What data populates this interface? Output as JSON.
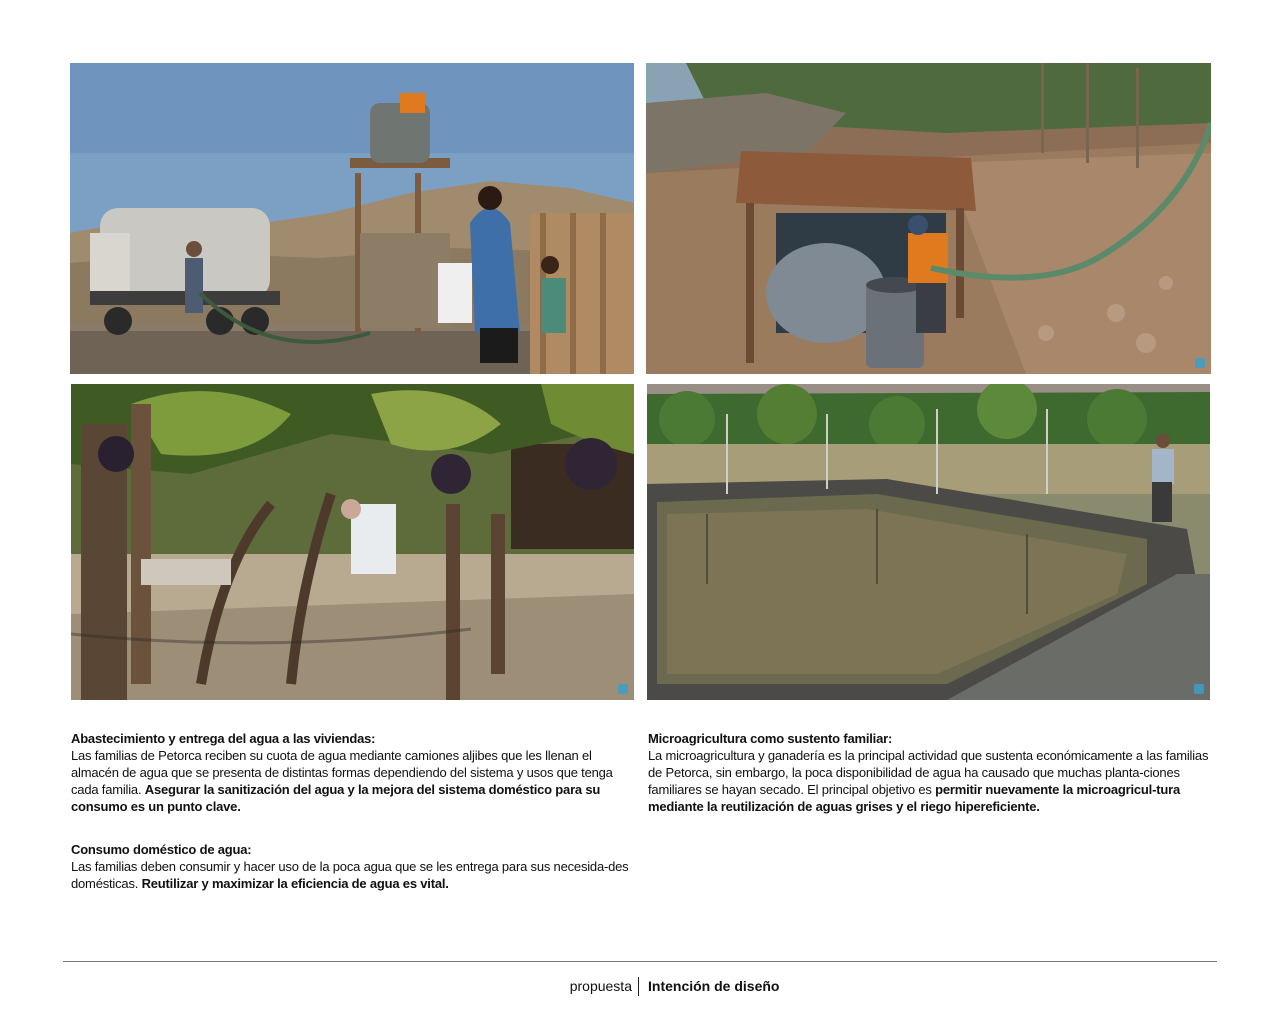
{
  "photos": [
    {
      "name": "water-truck-delivery-photo"
    },
    {
      "name": "water-tank-shelter-photo"
    },
    {
      "name": "grapevine-garden-photo"
    },
    {
      "name": "irrigation-pond-photo"
    }
  ],
  "blocks": {
    "supply": {
      "heading": "Abastecimiento y entrega del agua a las viviendas:",
      "body_plain": "Las familias de Petorca reciben su cuota de agua mediante camiones aljibes que les llenan el almacén de agua que se presenta de distintas formas dependiendo del sistema y usos que tenga cada familia. ",
      "body_bold": "Asegurar la sanitización del agua y la mejora del sistema doméstico para su consumo es un punto clave."
    },
    "domestic": {
      "heading": "Consumo doméstico de agua:",
      "body_plain": "Las familias deben consumir y hacer uso de la poca agua que se les entrega para sus necesida-des domésticas. ",
      "body_bold": "Reutilizar y maximizar la eficiencia de agua es vital."
    },
    "microagriculture": {
      "heading": "Microagricultura como sustento familiar:",
      "body_plain": "La microagricultura y ganadería es la principal actividad que sustenta económicamente a las familias de Petorca, sin embargo, la poca disponibilidad de agua ha causado que muchas planta-ciones familiares se hayan secado. El principal objetivo es ",
      "body_bold": "permitir nuevamente la microagricul-tura mediante la reutilización de aguas grises y el riego hipereficiente."
    }
  },
  "footer": {
    "section": "propuesta",
    "page_title": "Intención de diseño"
  }
}
